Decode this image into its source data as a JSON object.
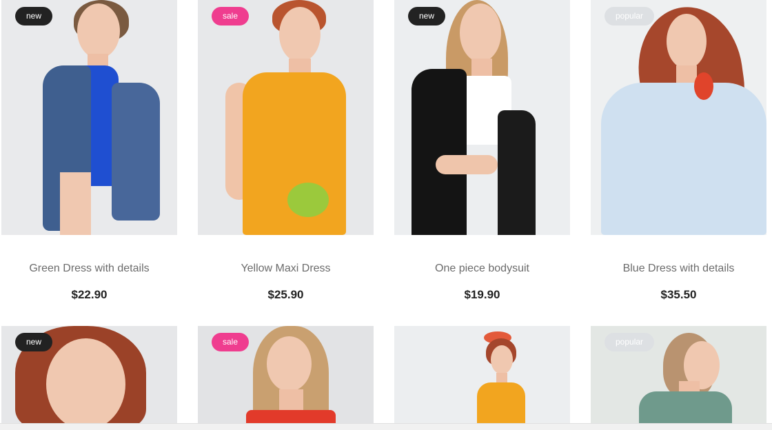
{
  "products": [
    {
      "badge": "new",
      "badge_type": "new",
      "title": "Green Dress with details",
      "price": "$22.90",
      "image": "woman-denim-jacket-blue-swimsuit"
    },
    {
      "badge": "sale",
      "badge_type": "sale",
      "title": "Yellow Maxi Dress",
      "price": "$25.90",
      "image": "woman-yellow-dress-flowers"
    },
    {
      "badge": "new",
      "badge_type": "new",
      "title": "One piece bodysuit",
      "price": "$19.90",
      "image": "woman-black-blazer-white-top"
    },
    {
      "badge": "popular",
      "badge_type": "popular",
      "title": "Blue Dress with details",
      "price": "$35.50",
      "image": "woman-light-blue-dress-red-flower"
    },
    {
      "badge": "new",
      "badge_type": "new",
      "image": "woman-red-hair-portrait"
    },
    {
      "badge": "sale",
      "badge_type": "sale",
      "image": "woman-red-off-shoulder-top"
    },
    {
      "badge": "",
      "badge_type": "none",
      "image": "woman-yellow-dress-flower-crown"
    },
    {
      "badge": "popular",
      "badge_type": "popular",
      "image": "woman-patterned-blouse-back"
    }
  ],
  "colors": {
    "badge_new": "#222222",
    "badge_sale": "#ef3d8f",
    "badge_popular": "#dde0e3",
    "title_text": "#6b6b6b",
    "price_text": "#222222"
  }
}
